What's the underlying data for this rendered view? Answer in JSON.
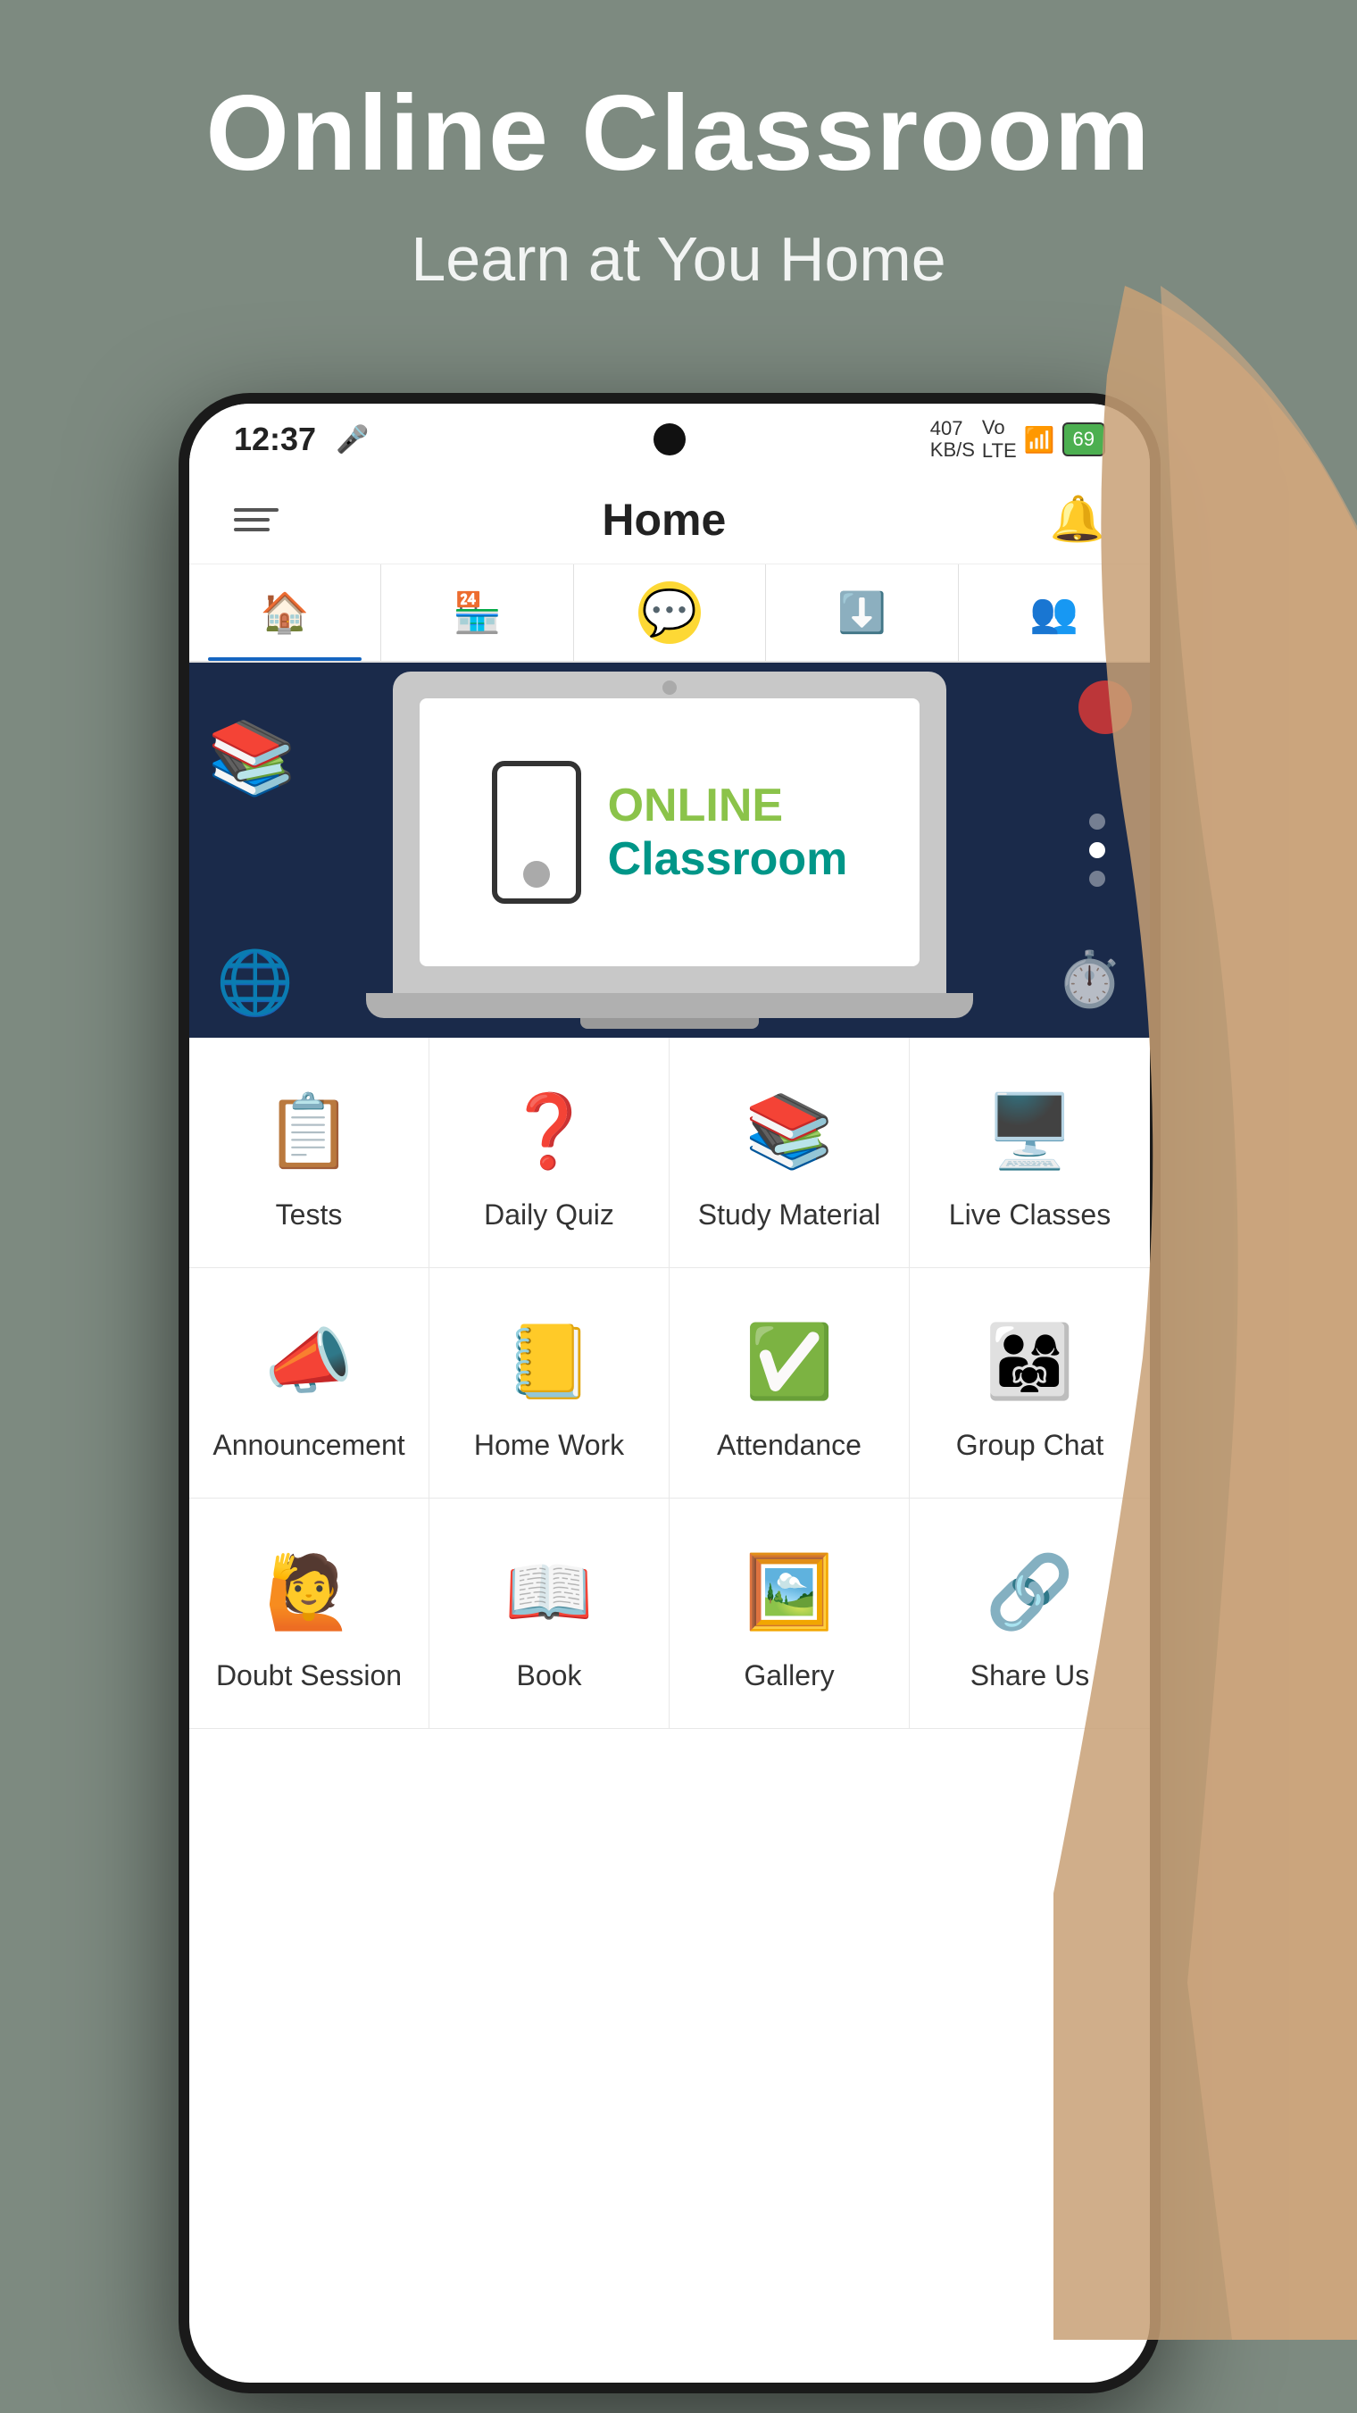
{
  "page": {
    "title": "Online Classroom",
    "subtitle": "Learn at You Home",
    "background_color": "#7d8a80"
  },
  "status_bar": {
    "time": "12:37",
    "signal_text": "407\nKB/S",
    "network": "Vo 4G",
    "battery": "69"
  },
  "header": {
    "title": "Home",
    "hamburger_label": "menu",
    "bell_label": "notifications"
  },
  "tabs": [
    {
      "icon": "🏠",
      "label": "home",
      "active": true
    },
    {
      "icon": "🏪",
      "label": "shop",
      "active": false
    },
    {
      "icon": "💬",
      "label": "chat",
      "active": false
    },
    {
      "icon": "⬇️",
      "label": "download",
      "active": false
    },
    {
      "icon": "👥",
      "label": "people",
      "active": false
    }
  ],
  "banner": {
    "online_text": "ONLINE",
    "classroom_text": "Classroom"
  },
  "menu_items": [
    {
      "id": "tests",
      "label": "Tests",
      "emoji": "📋",
      "color": "#1565C0"
    },
    {
      "id": "daily-quiz",
      "label": "Daily Quiz",
      "emoji": "❓",
      "color": "#FDD835"
    },
    {
      "id": "study-material",
      "label": "Study Material",
      "emoji": "📚",
      "color": "#FF7043"
    },
    {
      "id": "live-classes",
      "label": "Live Classes",
      "emoji": "🖥️",
      "color": "#4CAF50"
    },
    {
      "id": "announcement",
      "label": "Announcement",
      "emoji": "📣",
      "color": "#E91E63"
    },
    {
      "id": "home-work",
      "label": "Home Work",
      "emoji": "📒",
      "color": "#FF9800"
    },
    {
      "id": "attendance",
      "label": "Attendance",
      "emoji": "✅",
      "color": "#2196F3"
    },
    {
      "id": "group-chat",
      "label": "Group Chat",
      "emoji": "👨‍👩‍👧",
      "color": "#9C27B0"
    },
    {
      "id": "doubt-session",
      "label": "Doubt Session",
      "emoji": "🙋",
      "color": "#00BCD4"
    },
    {
      "id": "book",
      "label": "Book",
      "emoji": "📖",
      "color": "#FF5722"
    },
    {
      "id": "gallery",
      "label": "Gallery",
      "emoji": "🖼️",
      "color": "#4CAF50"
    },
    {
      "id": "share-us",
      "label": "Share Us",
      "emoji": "🔗",
      "color": "#2196F3"
    }
  ]
}
